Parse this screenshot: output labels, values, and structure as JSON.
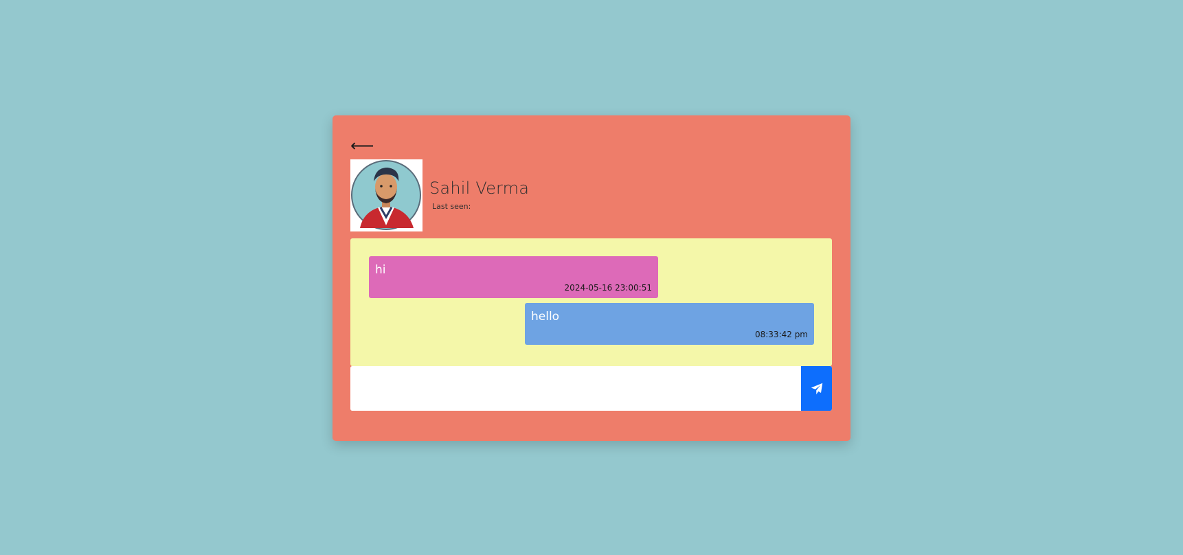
{
  "contact": {
    "name": "Sahil Verma",
    "last_seen": "Last seen:"
  },
  "header": {
    "back_icon": "arrow-left-icon",
    "back_glyph": "⟵"
  },
  "messages": [
    {
      "direction": "received",
      "text": "hi",
      "time": "2024-05-16 23:00:51"
    },
    {
      "direction": "sent",
      "text": "hello",
      "time": "08:33:42 pm"
    }
  ],
  "composer": {
    "value": "",
    "placeholder": "",
    "send_icon": "paper-plane-icon"
  },
  "colors": {
    "page_bg": "#94c8ce",
    "card_bg": "#ee7d6a",
    "chat_bg": "#f4f7a9",
    "received_bubble": "#dd6ab8",
    "sent_bubble": "#6ea3e3",
    "send_button": "#0d6efd"
  }
}
